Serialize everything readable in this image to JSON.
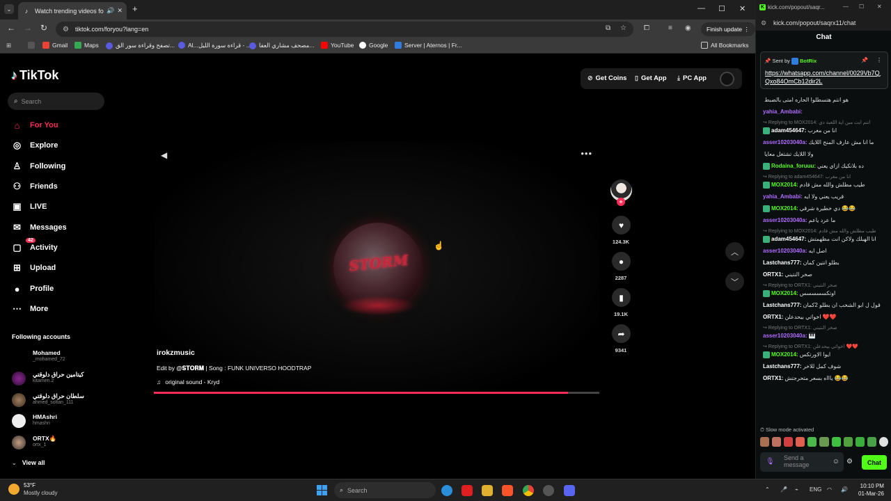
{
  "browser": {
    "tab_title": "Watch trending videos for y",
    "url": "tiktok.com/foryou?lang=en",
    "finish_update": "Finish update",
    "bookmarks": [
      "Gmail",
      "Maps",
      "تصفح وقراءة سور الق...",
      "Al...",
      "قراءة سورة الليل - ...",
      "مصحف مشاري العفا...",
      "YouTube",
      "Google",
      "Server | Aternos | Fr..."
    ],
    "all_bookmarks": "All Bookmarks"
  },
  "tiktok": {
    "logo": "TikTok",
    "search_placeholder": "Search",
    "nav": [
      {
        "label": "For You",
        "icon": "home-icon"
      },
      {
        "label": "Explore",
        "icon": "compass-icon"
      },
      {
        "label": "Following",
        "icon": "following-icon"
      },
      {
        "label": "Friends",
        "icon": "friends-icon"
      },
      {
        "label": "LIVE",
        "icon": "live-icon"
      },
      {
        "label": "Messages",
        "icon": "messages-icon"
      },
      {
        "label": "Activity",
        "icon": "activity-icon",
        "badge": "42"
      },
      {
        "label": "Upload",
        "icon": "upload-icon"
      },
      {
        "label": "Profile",
        "icon": "profile-icon"
      },
      {
        "label": "More",
        "icon": "more-icon"
      }
    ],
    "following_header": "Following accounts",
    "following": [
      {
        "name": "Mohamed",
        "user": "_mohamed_72"
      },
      {
        "name": "كيتامين حراق دلوقتي",
        "user": "kitamen.2"
      },
      {
        "name": "سلطان حراق دلوقتي",
        "user": "ahmed_soltan_111"
      },
      {
        "name": "HMAshri",
        "user": "hmashri"
      },
      {
        "name": "ORTX🔥",
        "user": "ortx_1"
      }
    ],
    "view_all": "View all",
    "top": {
      "coins": "Get Coins",
      "app": "Get App",
      "pc_app": "PC App"
    },
    "video": {
      "author": "irokzmusic",
      "desc_prefix": "Edit by ",
      "desc_mention": "@𝐒𝐓𝐎𝐑𝐌",
      "desc_suffix": " | Song : FUNK UNIVERSO HOODTRAP",
      "sound": "original sound - Kryd",
      "overlay_text": "STORM",
      "progress": 0.93
    },
    "actions": {
      "likes": "124.3K",
      "comments": "2287",
      "saves": "19.1K",
      "shares": "9341"
    }
  },
  "kick": {
    "url_title": "kick.com/popout/saqr...",
    "url": "kick.com/popout/saqrx11/chat",
    "chat_title": "Chat",
    "pinned_sender_label": "Sent by",
    "pinned_sender": "BotRix",
    "pinned_link": "https://whatsapp.com/channel/0029Vb7QQxo84OmCb12dir2L",
    "messages": [
      {
        "type": "msg",
        "user": "",
        "color": "#ddd",
        "text": "هو انتم هتسطلوا الحاره امتى بالضبط"
      },
      {
        "type": "msg",
        "user": "yahia_Ambabi:",
        "color": "#b06cff",
        "text": ""
      },
      {
        "type": "reply",
        "text": "Replying to MOX2014: انتم ابت مين اية اللعبة دي"
      },
      {
        "type": "msg",
        "user": "adam454647:",
        "color": "#ffffff",
        "text": "انا من مغرب",
        "badge": true
      },
      {
        "type": "msg",
        "user": "asser10203040a:",
        "color": "#b06cff",
        "text": "ما انا مش عارف المنح اللايك"
      },
      {
        "type": "msg",
        "user": "",
        "color": "#ddd",
        "text": "ولا اللايك تشتغل معايا"
      },
      {
        "type": "msg",
        "user": "Rodaina_foruuu:",
        "color": "#53fc18",
        "text": "ده بلانكيك ازاي يعني",
        "badge": true
      },
      {
        "type": "reply",
        "text": "Replying to adam454647: انا من مغرب"
      },
      {
        "type": "msg",
        "user": "MOX2014:",
        "color": "#53fc18",
        "text": "طيب مطلش والله مش قادم",
        "badge": true
      },
      {
        "type": "msg",
        "user": "yahia_Ambabi:",
        "color": "#b06cff",
        "text": "قريب يعني ولا ايه"
      },
      {
        "type": "msg",
        "user": "MOX2014:",
        "color": "#53fc18",
        "text": "دي خطيرة شرقي 😂😂",
        "badge": true
      },
      {
        "type": "msg",
        "user": "asser10203040a:",
        "color": "#b06cff",
        "text": "ما عرد ياعم"
      },
      {
        "type": "reply",
        "text": "Replying to MOX2014: طيب مطلش والله مش قادم"
      },
      {
        "type": "msg",
        "user": "adam454647:",
        "color": "#ffffff",
        "text": "انا الهبلك ولاكن انت مظهمتش",
        "badge": true
      },
      {
        "type": "msg",
        "user": "asser10203040a:",
        "color": "#b06cff",
        "text": "اصل ايه"
      },
      {
        "type": "msg",
        "user": "Lastchans777:",
        "color": "#ffffff",
        "text": "بطلو انتين كمان"
      },
      {
        "type": "msg",
        "user": "ORTX1:",
        "color": "#ffffff",
        "text": "صخر النتيني"
      },
      {
        "type": "reply",
        "text": "Replying to ORTX1: صخر النتيني"
      },
      {
        "type": "msg",
        "user": "MOX2014:",
        "color": "#53fc18",
        "text": "اوتكسسسسس",
        "badge": true
      },
      {
        "type": "msg",
        "user": "Lastchans777:",
        "color": "#ffffff",
        "text": "قول ل ابو الشخب ان بطلو 2كمان"
      },
      {
        "type": "msg",
        "user": "ORTX1:",
        "color": "#ffffff",
        "text": "اخواتي بيحدعلن ❤️❤️"
      },
      {
        "type": "reply",
        "text": "Replying to ORTX1: صخر النتيني"
      },
      {
        "type": "msg",
        "user": "asser10203040a:",
        "color": "#b06cff",
        "text": "🎹"
      },
      {
        "type": "reply",
        "text": "Replying to ORTX1: اخواتي بيحدعلن ❤️❤️"
      },
      {
        "type": "msg",
        "user": "MOX2014:",
        "color": "#53fc18",
        "text": "ايوا الاورتكس",
        "badge": true
      },
      {
        "type": "msg",
        "user": "Lastchans777:",
        "color": "#ffffff",
        "text": "شوف كمل للاخر"
      },
      {
        "type": "msg",
        "user": "ORTX1:",
        "color": "#ffffff",
        "text": "ياااه بسعر متحرجتش 😂😂"
      }
    ],
    "slow_mode": "Slow mode activated",
    "input_placeholder": "Send a message",
    "send_label": "Chat"
  },
  "taskbar": {
    "temp": "53°F",
    "weather": "Mostly cloudy",
    "search": "Search",
    "lang": "ENG",
    "time": "10:10 PM",
    "date": "01-Mar-26"
  }
}
